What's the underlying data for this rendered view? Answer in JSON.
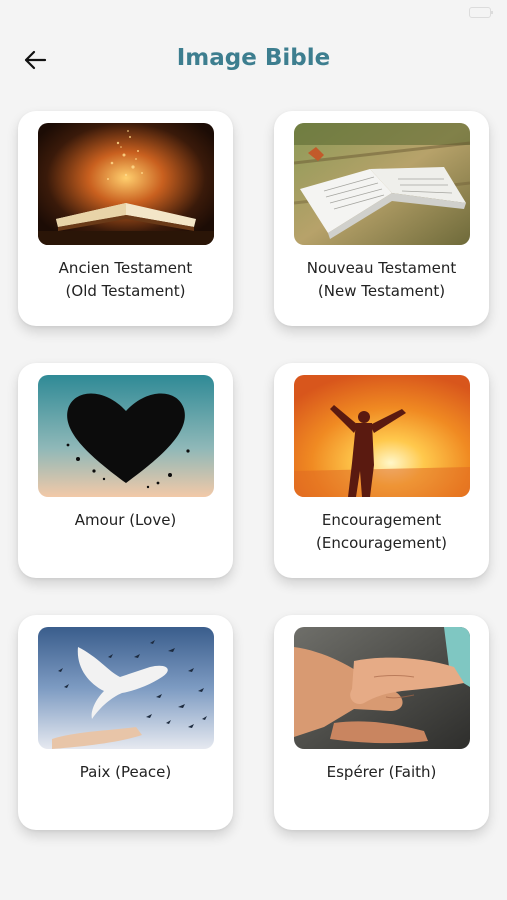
{
  "header": {
    "title": "Image Bible",
    "back_icon": "arrow-left-icon"
  },
  "categories": [
    {
      "title": "Ancien Testament",
      "subtitle": "(Old Testament)",
      "image": "open-bible-glowing"
    },
    {
      "title": "Nouveau Testament",
      "subtitle": "(New Testament)",
      "image": "open-bible-on-table"
    },
    {
      "title": "Amour (Love)",
      "subtitle": "",
      "image": "heart-silhouette"
    },
    {
      "title": "Encouragement",
      "subtitle": "(Encouragement)",
      "image": "person-arms-raised-sunset"
    },
    {
      "title": "Paix (Peace)",
      "subtitle": "",
      "image": "dove-flying-birds"
    },
    {
      "title": "Espérer (Faith)",
      "subtitle": "",
      "image": "holding-hands"
    }
  ],
  "colors": {
    "title": "#3d7e8f",
    "background": "#f4f4f4",
    "card": "#ffffff"
  }
}
